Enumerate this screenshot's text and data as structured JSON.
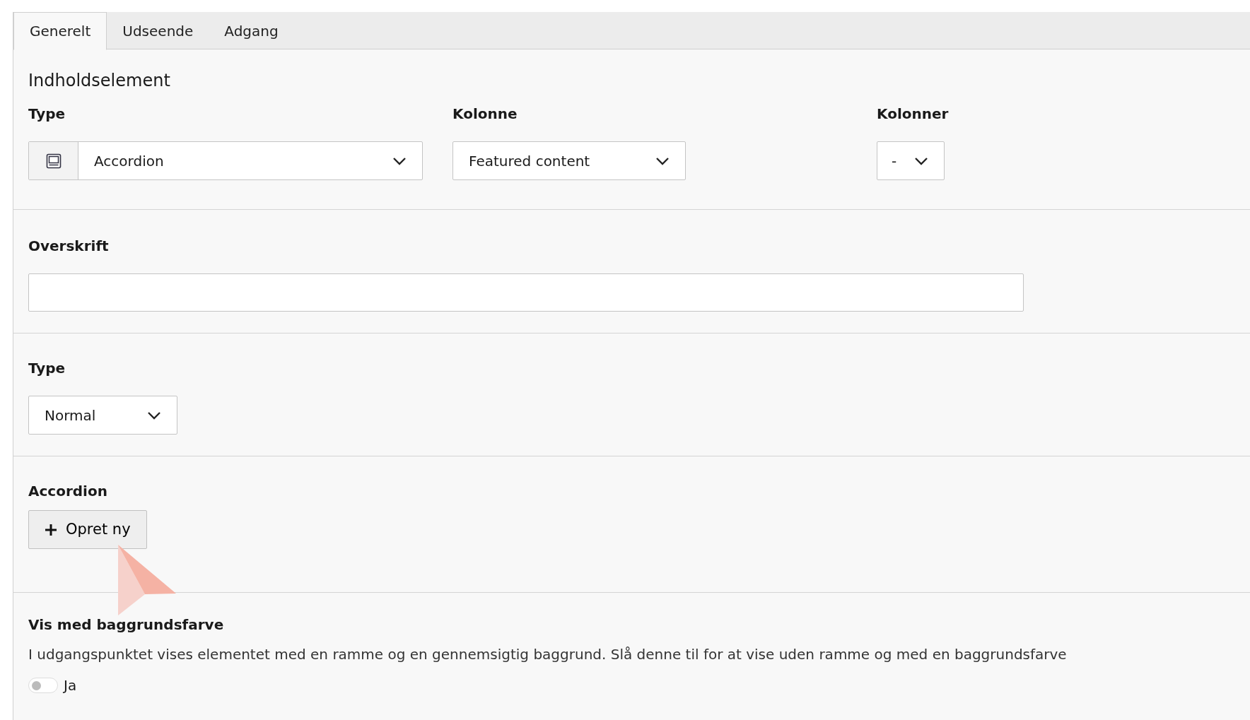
{
  "tabs": [
    {
      "label": "Generelt",
      "selected": true
    },
    {
      "label": "Udseende",
      "selected": false
    },
    {
      "label": "Adgang",
      "selected": false
    }
  ],
  "section_title": "Indholdselement",
  "selects": [
    {
      "label": "Type",
      "value": "Accordion",
      "kind": "icon"
    },
    {
      "label": "Kolonne",
      "value": "Featured content",
      "kind": "plain"
    },
    {
      "label": "Kolonner",
      "value": "-",
      "kind": "plain"
    }
  ],
  "heading_field": {
    "label": "Overskrift"
  },
  "type_field": {
    "label": "Type",
    "value": "Normal"
  },
  "accordion": {
    "label": "Accordion",
    "button": "Opret ny"
  },
  "background": {
    "label": "Vis med baggrundsfarve",
    "description": "I udgangspunktet vises elementet med en ramme og en gennemsigtig baggrund. Slå denne til for at vise uden ramme og med en baggrundsfarve",
    "toggle_label": "Ja",
    "on": false
  }
}
